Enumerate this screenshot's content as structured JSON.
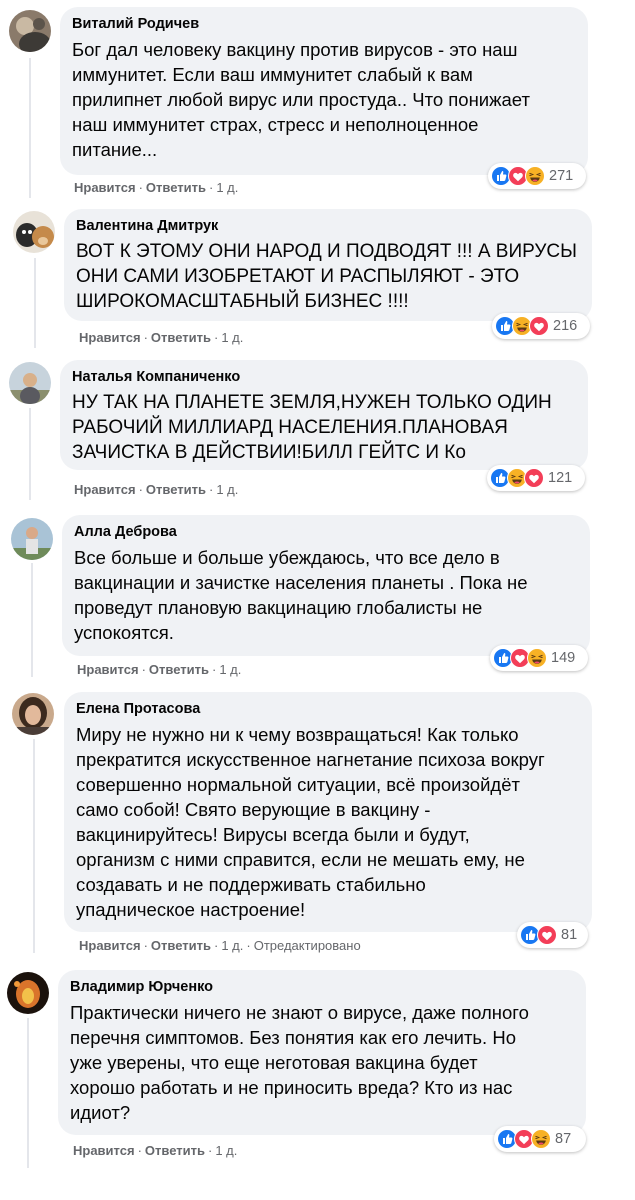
{
  "colors": {
    "bubble_bg": "#f0f2f5",
    "meta_text": "#65676b",
    "like_blue": "#1877f2",
    "love_red": "#f33e58",
    "haha_yellow": "#f7b125"
  },
  "comments": [
    {
      "author": "Виталий Родичев",
      "lines": [
        "Бог дал человеку вакцину против вирусов - это наш",
        "иммунитет. Если ваш иммунитет слабый к вам",
        "прилипнет любой вирус или простуда.. Что понижает",
        "наш иммунитет страх, стресс и неполноценное",
        "питание..."
      ],
      "like_label": "Нравится",
      "reply_label": "Ответить",
      "time": "1 д.",
      "reactions": [
        "like-icon",
        "love-icon",
        "haha-icon"
      ],
      "reaction_count": "271"
    },
    {
      "author": "Валентина Дмитрук",
      "lines": [
        "ВОТ К ЭТОМУ ОНИ НАРОД И ПОДВОДЯТ !!! А ВИРУСЫ",
        "ОНИ САМИ ИЗОБРЕТАЮТ И РАСПЫЛЯЮТ - ЭТО",
        "ШИРОКОМАСШТАБНЫЙ БИЗНЕС !!!!"
      ],
      "like_label": "Нравится",
      "reply_label": "Ответить",
      "time": "1 д.",
      "reactions": [
        "like-icon",
        "haha-icon",
        "love-icon"
      ],
      "reaction_count": "216"
    },
    {
      "author": "Наталья Компаниченко",
      "lines": [
        "НУ ТАК НА ПЛАНЕТЕ ЗЕМЛЯ,НУЖЕН ТОЛЬКО ОДИН",
        "РАБОЧИЙ МИЛЛИАРД НАСЕЛЕНИЯ.ПЛАНОВАЯ",
        "ЗАЧИСТКА В ДЕЙСТВИИ!БИЛЛ ГЕЙТС И Ко"
      ],
      "like_label": "Нравится",
      "reply_label": "Ответить",
      "time": "1 д.",
      "reactions": [
        "like-icon",
        "haha-icon",
        "love-icon"
      ],
      "reaction_count": "121"
    },
    {
      "author": "Алла Деброва",
      "lines": [
        "Все больше и больше убеждаюсь, что все дело в",
        "вакцинации и зачистке населения планеты . Пока не",
        "проведут плановую вакцинацию глобалисты не",
        "успокоятся."
      ],
      "like_label": "Нравится",
      "reply_label": "Ответить",
      "time": "1 д.",
      "reactions": [
        "like-icon",
        "love-icon",
        "haha-icon"
      ],
      "reaction_count": "149"
    },
    {
      "author": "Елена Протасова",
      "lines": [
        "Миру не нужно ни к чему возвращаться! Как только",
        "прекратится искусственное нагнетание психоза вокруг",
        "совершенно нормальной ситуации, всё произойдёт",
        "само собой! Свято верующие в вакцину -",
        "вакцинируйтесь! Вирусы всегда были и будут,",
        "организм с ними справится, если не мешать ему, не",
        "создавать и не поддерживать стабильно",
        "упадническое настроение!"
      ],
      "like_label": "Нравится",
      "reply_label": "Ответить",
      "time": "1 д.",
      "edited": "Отредактировано",
      "reactions": [
        "like-icon",
        "love-icon"
      ],
      "reaction_count": "81"
    },
    {
      "author": "Владимир Юрченко",
      "lines": [
        "Практически ничего не знают о вирусе, даже полного",
        "перечня симптомов. Без понятия как его лечить. Но",
        "уже уверены, что еще неготовая вакцина будет",
        "хорошо работать и не приносить вреда? Кто из нас",
        "идиот?"
      ],
      "like_label": "Нравится",
      "reply_label": "Ответить",
      "time": "1 д.",
      "reactions": [
        "like-icon",
        "love-icon",
        "haha-icon"
      ],
      "reaction_count": "87"
    }
  ]
}
